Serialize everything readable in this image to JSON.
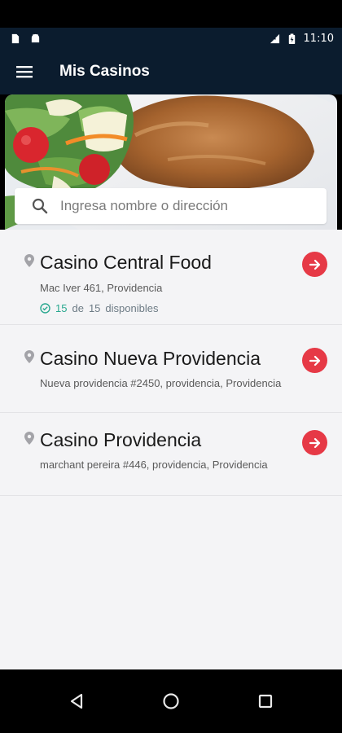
{
  "status_bar": {
    "time": "11:10",
    "icons_left": [
      "sim-card-icon",
      "android-icon"
    ],
    "icons_right": [
      "no-signal-icon",
      "battery-charging-icon"
    ]
  },
  "app_bar": {
    "title": "Mis Casinos",
    "menu_icon": "hamburger-menu-icon"
  },
  "search": {
    "placeholder": "Ingresa nombre o dirección",
    "value": ""
  },
  "casinos": [
    {
      "name": "Casino Central Food",
      "address": "Mac Iver 461, Providencia",
      "available": "15",
      "de": "de",
      "total": "15",
      "available_label": "disponibles"
    },
    {
      "name": "Casino Nueva Providencia",
      "address": "Nueva providencia #2450, providencia, Providencia"
    },
    {
      "name": "Casino Providencia",
      "address": "marchant pereira #446, providencia, Providencia"
    }
  ],
  "colors": {
    "app_bar_bg": "#0b1c2e",
    "accent_red": "#e63946",
    "available_green": "#2aa88f",
    "content_bg": "#f4f4f6"
  },
  "nav_bar": {
    "icons": [
      "back-triangle-icon",
      "home-circle-icon",
      "recents-square-icon"
    ]
  }
}
